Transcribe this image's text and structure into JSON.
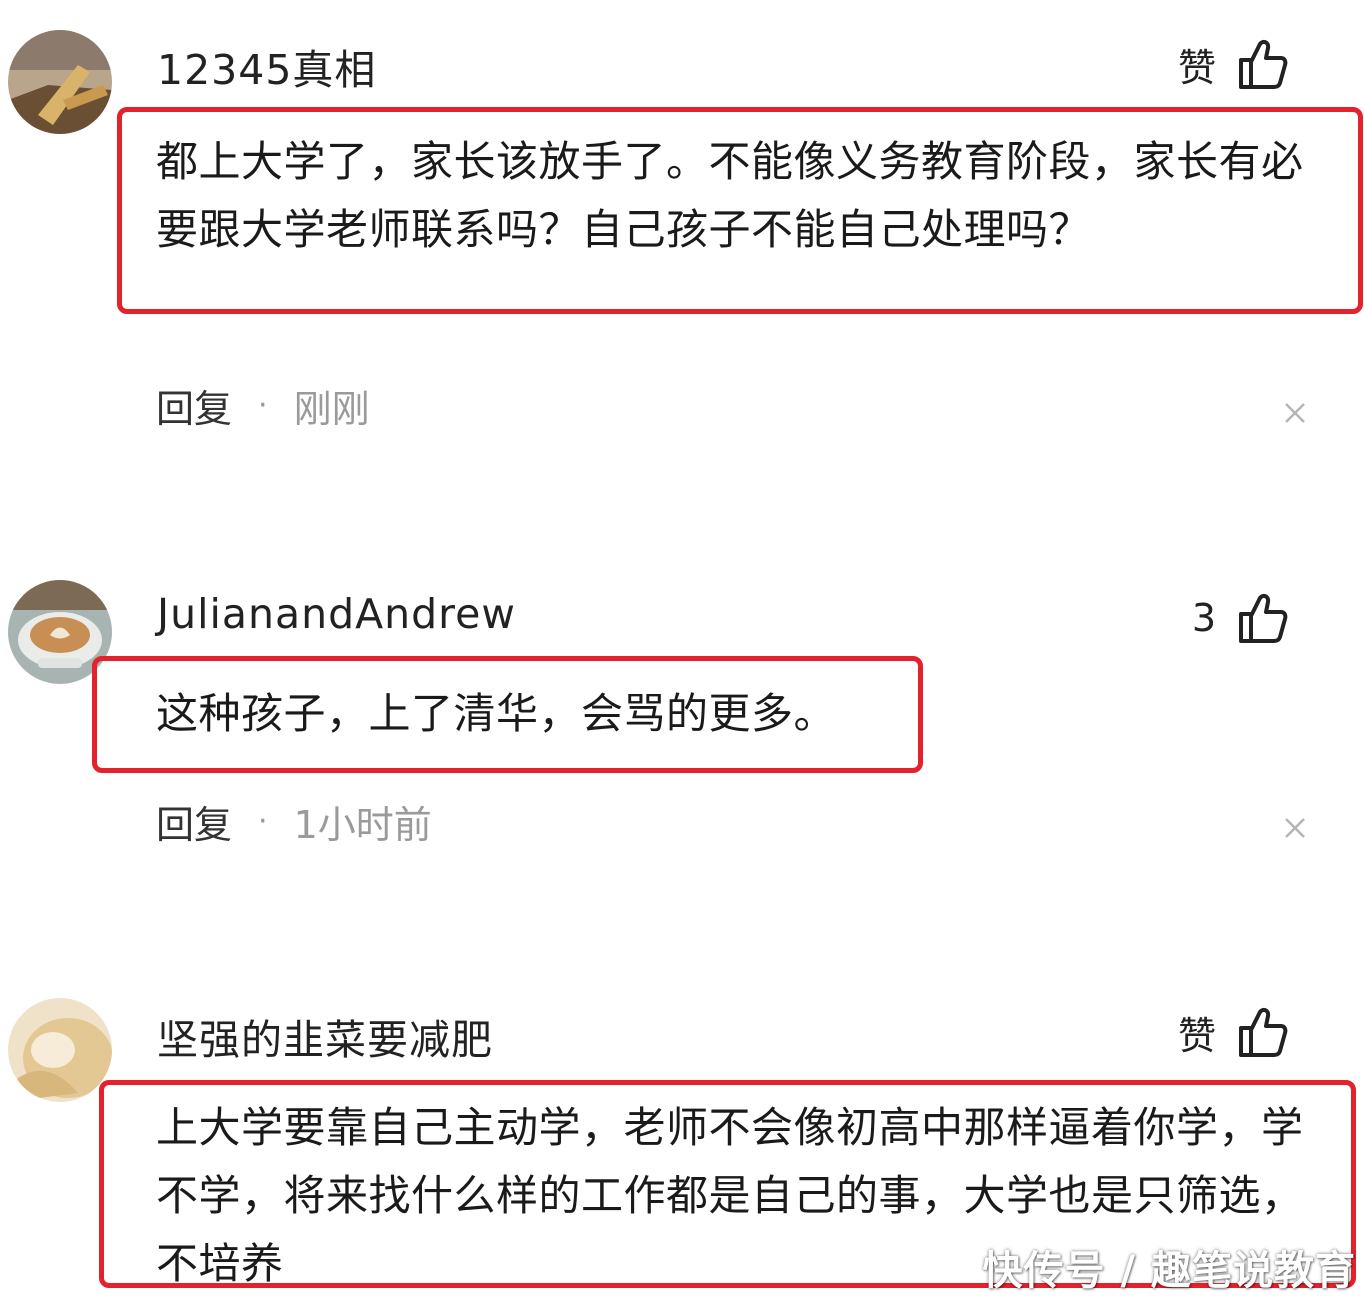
{
  "comments": [
    {
      "username": "12345真相",
      "like_label": "赞",
      "text": "都上大学了，家长该放手了。不能像义务教育阶段，家长有必要跟大学老师联系吗？自己孩子不能自己处理吗？",
      "reply_label": "回复",
      "time": "刚刚"
    },
    {
      "username": "JulianandAndrew",
      "like_label": "3",
      "text": "这种孩子，上了清华，会骂的更多。",
      "reply_label": "回复",
      "time": "1小时前"
    },
    {
      "username": "坚强的韭菜要减肥",
      "like_label": "赞",
      "text": "上大学要靠自己主动学，老师不会像初高中那样逼着你学，学不学，将来找什么样的工作都是自己的事，大学也是只筛选，不培养",
      "reply_label": "回复",
      "time": ""
    }
  ],
  "separator": "·",
  "watermark": "快传号 / 趣笔说教育",
  "colors": {
    "highlight": "#e4222c",
    "muted": "#9a9a9a",
    "text": "#1a1a1a"
  },
  "icons": {
    "like": "thumbs-up-icon",
    "close": "close-icon"
  }
}
